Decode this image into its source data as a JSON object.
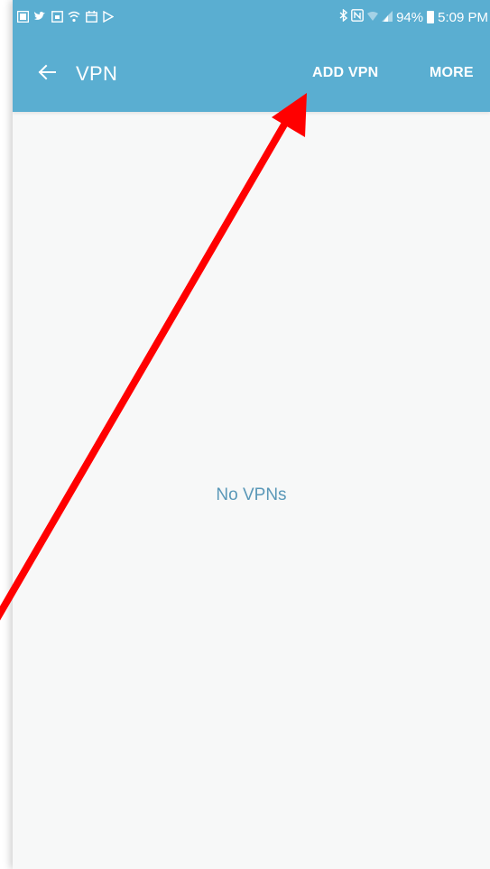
{
  "status_bar": {
    "battery": "94%",
    "time": "5:09 PM",
    "icons_left": [
      "notification-icon",
      "twitter-icon",
      "screenshot-icon",
      "wifi-icon",
      "calendar-icon",
      "play-store-icon"
    ],
    "icons_right": [
      "bluetooth-icon",
      "nfc-icon",
      "wifi-signal-icon",
      "cell-signal-icon",
      "battery-icon"
    ]
  },
  "app_bar": {
    "title": "VPN",
    "actions": {
      "add_vpn": "ADD VPN",
      "more": "MORE"
    }
  },
  "main": {
    "empty_message": "No VPNs"
  },
  "annotation": {
    "color": "#ff0000",
    "type": "arrow",
    "target": "ADD VPN"
  },
  "colors": {
    "accent": "#5aaed1",
    "background": "#f7f8f8",
    "empty_text": "#5a98b8"
  }
}
